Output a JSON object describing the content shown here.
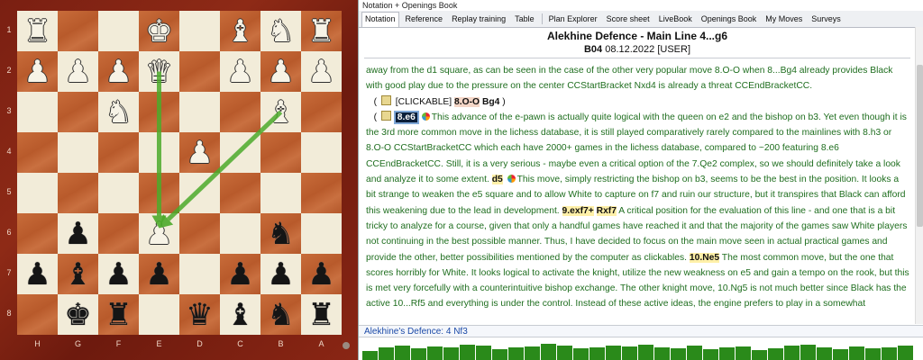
{
  "window": {
    "title": "Notation + Openings Book"
  },
  "tabs": [
    {
      "label": "Notation",
      "active": true
    },
    {
      "label": "Reference"
    },
    {
      "label": "Replay training"
    },
    {
      "label": "Table"
    },
    {
      "label": "Plan Explorer"
    },
    {
      "label": "Score sheet"
    },
    {
      "label": "LiveBook"
    },
    {
      "label": "Openings Book"
    },
    {
      "label": "My Moves"
    },
    {
      "label": "Surveys"
    }
  ],
  "game": {
    "title": "Alekhine Defence - Main Line 4...g6",
    "eco": "B04",
    "date_user": "08.12.2022 [USER]"
  },
  "notation": {
    "p1": "away from the  d1 square, as can be seen in the case of the other very popular move 8.O-O  when 8...Bg4 already provides Black with good play due to the pressure on the  center ",
    "p1b": "StartBracket",
    "p1c": " Nxd4 is already a threat ",
    "p1d": "EndBracket",
    "cc": "CC",
    "clickable_tag": "[CLICKABLE]",
    "var1_move": "8.O-O",
    "var1_reply": "Bg4",
    "cur_move": "8.e6",
    "p2": "This advance of the e-pawn is actually quite logical with the queen on e2 and the bishop on b3. Yet even though it is the 3rd more common move in the lichess database, it is still played comparatively rarely compared to the mainlines with 8.h3 or 8.O-O ",
    "p2b": " which each have 2000+ games in the lichess database, compared to ~200 featuring 8.e6 ",
    "p2c": ". Still, it is a very serious - maybe even a critical option of the 7.Qe2 complex, so we should definitely take a look and analyze it to some extent.",
    "mv_d5": "d5",
    "p3": "This move, simply restricting the bishop on b3, seems to be the best in the position. It looks a bit strange to weaken the e5 square and to allow White to capture on f7 and ruin our structure, but it transpires that Black can afford this weakening due to the lead in development.",
    "mv_exf7": "9.exf7+",
    "mv_rxf7": "Rxf7",
    "p4": "A critical position for the  evaluation of this line - and one that is a bit tricky to analyze for a course,  given that only a handful games have reached it and that the majority of the  games saw White players not continuing in the best possible manner. Thus, I have decided to focus on the main move seen in actual practical games and  provide the other, better possibilities mentioned by the computer as  clickables.",
    "mv_ne5": "10.Ne5",
    "p5": "The most common move, but the one that scores horribly  for White. It looks logical to activate the knight, utilize the new weakness  on e5 and gain a tempo on the rook, but this is met very forcefully with a  counterintuitive bishop exchange. The other knight move, 10.Ng5 is not much  better since Black has the active 10...Rf5 and everything is under the control.  Instead of these active ideas, the engine prefers to play in a somewhat"
  },
  "opening_bar": "Alekhine's Defence: 4 Nf3",
  "board": {
    "ranks": [
      "1",
      "2",
      "3",
      "4",
      "5",
      "6",
      "7",
      "8"
    ],
    "files": [
      "H",
      "G",
      "F",
      "E",
      "D",
      "C",
      "B",
      "A"
    ],
    "pieces": [
      {
        "row": 0,
        "col": 0,
        "glyph": "♜",
        "color": "w",
        "name": "white-rook-h1"
      },
      {
        "row": 0,
        "col": 3,
        "glyph": "♚",
        "color": "w",
        "name": "white-king-e1"
      },
      {
        "row": 0,
        "col": 5,
        "glyph": "♝",
        "color": "w",
        "name": "white-bishop-c1"
      },
      {
        "row": 0,
        "col": 6,
        "glyph": "♞",
        "color": "w",
        "name": "white-knight-b1"
      },
      {
        "row": 0,
        "col": 7,
        "glyph": "♜",
        "color": "w",
        "name": "white-rook-a1"
      },
      {
        "row": 1,
        "col": 0,
        "glyph": "♟",
        "color": "w",
        "name": "white-pawn-h2"
      },
      {
        "row": 1,
        "col": 1,
        "glyph": "♟",
        "color": "w",
        "name": "white-pawn-g2"
      },
      {
        "row": 1,
        "col": 2,
        "glyph": "♟",
        "color": "w",
        "name": "white-pawn-f2"
      },
      {
        "row": 1,
        "col": 3,
        "glyph": "♛",
        "color": "w",
        "name": "white-queen-e2"
      },
      {
        "row": 1,
        "col": 5,
        "glyph": "♟",
        "color": "w",
        "name": "white-pawn-c2"
      },
      {
        "row": 1,
        "col": 6,
        "glyph": "♟",
        "color": "w",
        "name": "white-pawn-b2"
      },
      {
        "row": 1,
        "col": 7,
        "glyph": "♟",
        "color": "w",
        "name": "white-pawn-a2"
      },
      {
        "row": 2,
        "col": 2,
        "glyph": "♞",
        "color": "w",
        "name": "white-knight-f3"
      },
      {
        "row": 2,
        "col": 6,
        "glyph": "♝",
        "color": "w",
        "name": "white-bishop-b3"
      },
      {
        "row": 3,
        "col": 4,
        "glyph": "♟",
        "color": "w",
        "name": "white-pawn-d4"
      },
      {
        "row": 5,
        "col": 1,
        "glyph": "♟",
        "color": "b",
        "name": "black-pawn-g6"
      },
      {
        "row": 5,
        "col": 3,
        "glyph": "♟",
        "color": "w",
        "name": "white-pawn-e6"
      },
      {
        "row": 5,
        "col": 6,
        "glyph": "♞",
        "color": "b",
        "name": "black-knight-b6"
      },
      {
        "row": 6,
        "col": 0,
        "glyph": "♟",
        "color": "b",
        "name": "black-pawn-h7"
      },
      {
        "row": 6,
        "col": 1,
        "glyph": "♝",
        "color": "b",
        "name": "black-bishop-g7"
      },
      {
        "row": 6,
        "col": 2,
        "glyph": "♟",
        "color": "b",
        "name": "black-pawn-f7"
      },
      {
        "row": 6,
        "col": 3,
        "glyph": "♟",
        "color": "b",
        "name": "black-pawn-e7"
      },
      {
        "row": 6,
        "col": 5,
        "glyph": "♟",
        "color": "b",
        "name": "black-pawn-c7"
      },
      {
        "row": 6,
        "col": 6,
        "glyph": "♟",
        "color": "b",
        "name": "black-pawn-b7"
      },
      {
        "row": 6,
        "col": 7,
        "glyph": "♟",
        "color": "b",
        "name": "black-pawn-a7"
      },
      {
        "row": 7,
        "col": 1,
        "glyph": "♚",
        "color": "b",
        "name": "black-king-g8"
      },
      {
        "row": 7,
        "col": 2,
        "glyph": "♜",
        "color": "b",
        "name": "black-rook-f8"
      },
      {
        "row": 7,
        "col": 4,
        "glyph": "♛",
        "color": "b",
        "name": "black-queen-d8"
      },
      {
        "row": 7,
        "col": 5,
        "glyph": "♝",
        "color": "b",
        "name": "black-bishop-c8"
      },
      {
        "row": 7,
        "col": 6,
        "glyph": "♞",
        "color": "b",
        "name": "black-knight-b8"
      },
      {
        "row": 7,
        "col": 7,
        "glyph": "♜",
        "color": "b",
        "name": "black-rook-a8"
      }
    ],
    "arrows": [
      {
        "from": [
          1,
          3
        ],
        "to": [
          5,
          3
        ],
        "color": "#4caa2a"
      },
      {
        "from": [
          2,
          6
        ],
        "to": [
          5,
          3
        ],
        "color": "#4caa2a"
      }
    ]
  },
  "colors": {
    "notation_text": "#1f6e1f",
    "accent": "#1b4aa8",
    "graph_bar": "#2a8a1a"
  }
}
